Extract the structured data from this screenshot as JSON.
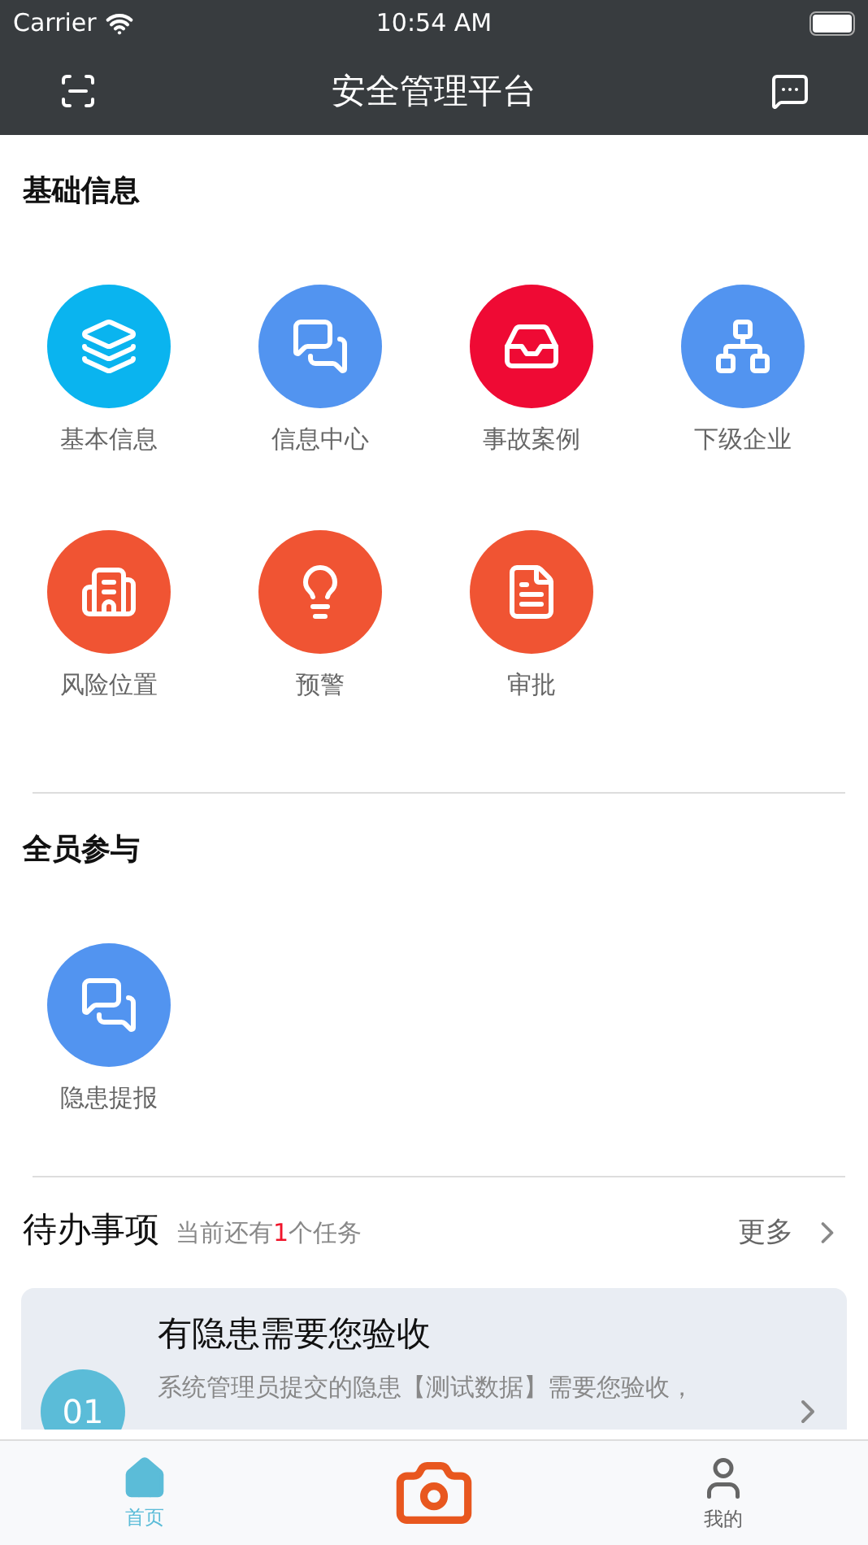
{
  "status_bar": {
    "carrier": "Carrier",
    "time": "10:54 AM"
  },
  "nav": {
    "title": "安全管理平台"
  },
  "sections": [
    {
      "title": "基础信息",
      "items": [
        {
          "label": "基本信息",
          "color": "#0ab4ef"
        },
        {
          "label": "信息中心",
          "color": "#5294f0"
        },
        {
          "label": "事故案例",
          "color": "#ef0a34"
        },
        {
          "label": "下级企业",
          "color": "#5294f0"
        },
        {
          "label": "风险位置",
          "color": "#f05433"
        },
        {
          "label": "预警",
          "color": "#f05433"
        },
        {
          "label": "审批",
          "color": "#f05433"
        }
      ]
    },
    {
      "title": "全员参与",
      "items": [
        {
          "label": "隐患提报",
          "color": "#5294f0"
        }
      ]
    }
  ],
  "todo": {
    "title": "待办事项",
    "summary": "当前还有**1**个任务",
    "more": "更多",
    "tasks": [
      {
        "number": "01",
        "title": "有隐患需要您验收",
        "text": "系统管理员提交的隐患【测试数据】需要您验收，"
      }
    ]
  },
  "tab_bar": [
    {
      "kind": "home",
      "label": "首页",
      "selected": true
    },
    {
      "kind": "camera",
      "selected": false
    },
    {
      "kind": "profile",
      "label": "我的",
      "selected": false
    }
  ]
}
